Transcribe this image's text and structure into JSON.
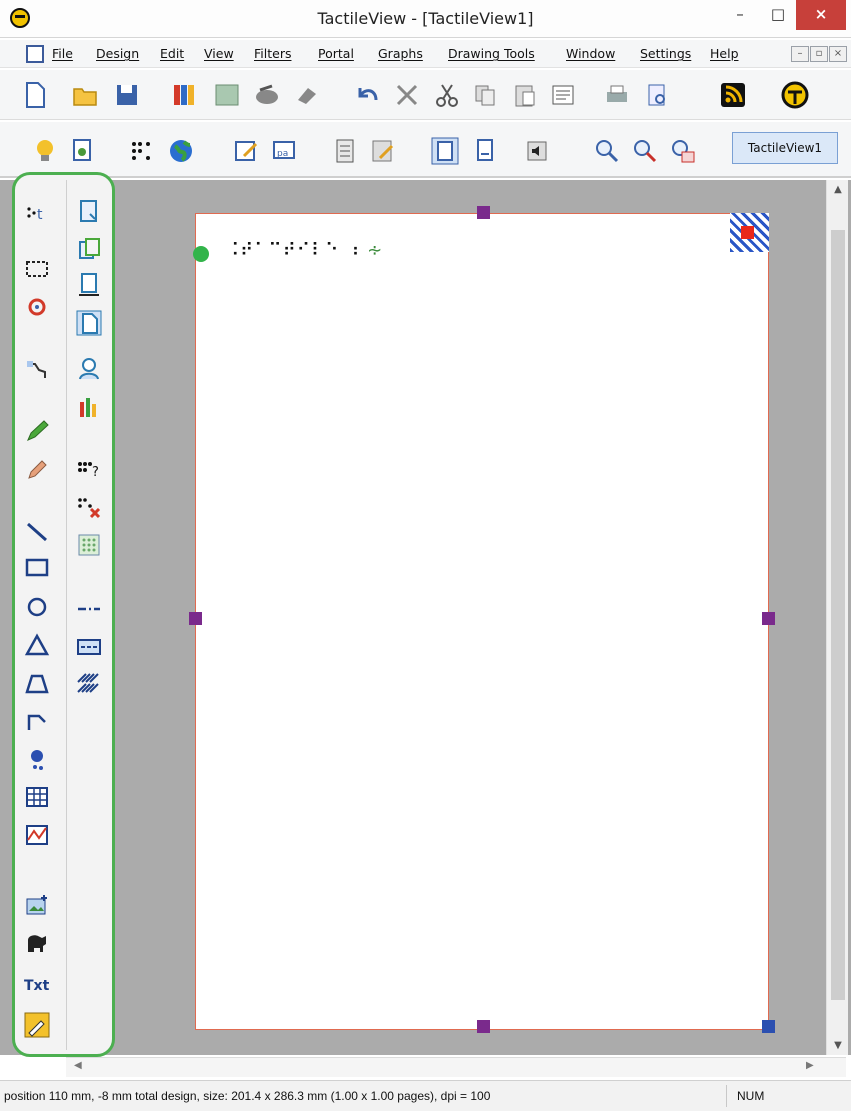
{
  "window": {
    "title": "TactileView - [TactileView1]",
    "min_glyph": "–",
    "max_glyph": "□",
    "close_glyph": "×"
  },
  "menu": {
    "items": [
      "File",
      "Design",
      "Edit",
      "View",
      "Filters",
      "Portal",
      "Graphs",
      "Drawing Tools",
      "Window",
      "Settings",
      "Help"
    ],
    "mdi_controls": [
      "–",
      "▫",
      "×"
    ]
  },
  "toolbar1": {
    "icons": [
      "new-document-icon",
      "open-folder-icon",
      "save-icon",
      "books-icon",
      "image-gallery-icon",
      "scanner-icon",
      "eraser-icon",
      "undo-icon",
      "delete-icon",
      "cut-icon",
      "copy-icon",
      "paste-icon",
      "paste-special-icon",
      "print-icon",
      "print-preview-icon",
      "rss-feed-icon",
      "tactileview-portal-icon"
    ]
  },
  "toolbar2": {
    "icons": [
      "bulb-icon",
      "settings-document-icon",
      "braille-icon",
      "globe-icon",
      "edit-design-icon",
      "braille-text-icon",
      "calculator-icon",
      "drawing-edit-icon",
      "page-view-icon",
      "page-single-icon",
      "audio-icon",
      "zoom-in-icon",
      "zoom-out-icon",
      "zoom-fit-icon"
    ],
    "document_tab": "TactileView1"
  },
  "palette": {
    "left_column": [
      "braille-text-tool-icon",
      "select-rectangle-icon",
      "rotate-icon",
      "lasso-icon",
      "pencil-icon",
      "eraser-tool-icon",
      "line-tool-icon",
      "rectangle-tool-icon",
      "ellipse-tool-icon",
      "triangle-tool-icon",
      "trapezoid-tool-icon",
      "polyline-tool-icon",
      "point-tool-icon",
      "table-tool-icon",
      "graph-tool-icon",
      "insert-image-icon",
      "animal-symbol-icon",
      "text-tool-icon",
      "color-picker-icon"
    ],
    "right_column": [
      "page-setup-icon",
      "page-copy-icon",
      "page-size-icon",
      "page-orientation-icon",
      "user-icon",
      "chart-icon",
      "braille-check-icon",
      "braille-delete-icon",
      "pattern-fill-icon",
      "line-style-icon",
      "dashed-box-icon",
      "hatch-fill-icon"
    ],
    "text_label": "Txt"
  },
  "canvas": {
    "braille_text": "⠨⠞⠁⠉⠞⠊⠇⠑ ⠰",
    "braille_suffix": "∻"
  },
  "status": {
    "text": "position 110 mm, -8 mm total design, size: 201.4 x 286.3 mm (1.00 x 1.00 pages), dpi = 100",
    "num": "NUM"
  },
  "colors": {
    "palette_frame": "#4caf50",
    "page_border": "#e06a50",
    "selection_handle": "#7a2a8c",
    "workspace": "#ababab",
    "close_button": "#c7403a"
  }
}
